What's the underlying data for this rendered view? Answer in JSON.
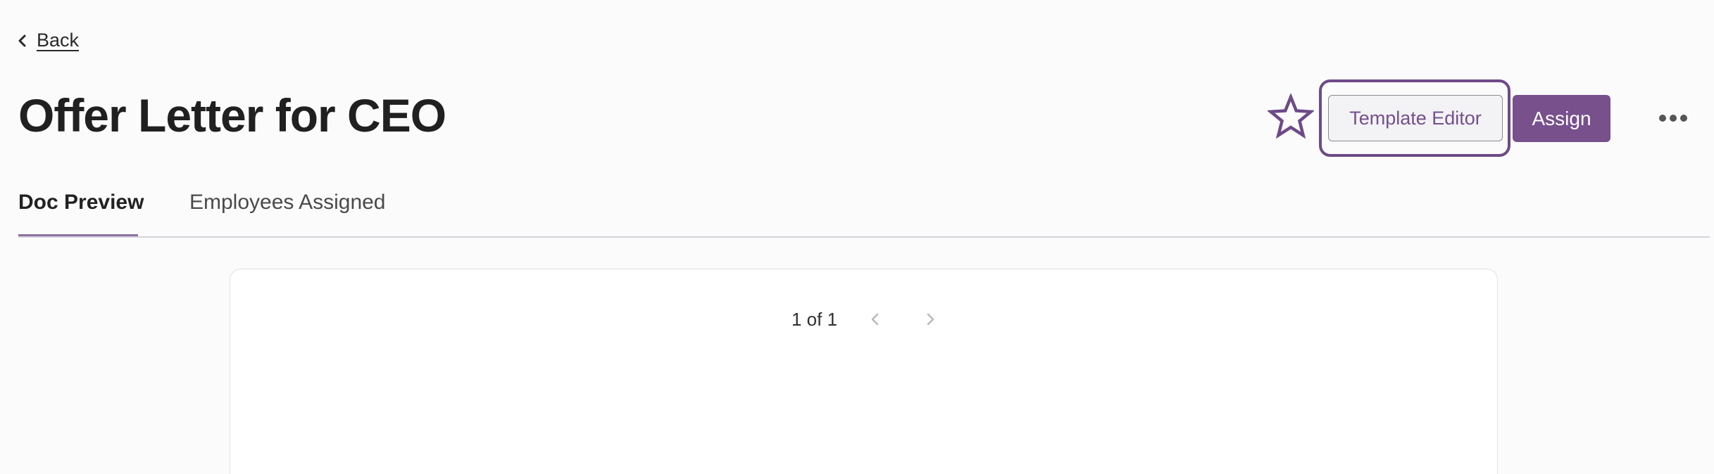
{
  "nav": {
    "back_label": "Back"
  },
  "header": {
    "title": "Offer Letter for CEO",
    "template_editor_label": "Template Editor",
    "assign_label": "Assign"
  },
  "tabs": [
    {
      "label": "Doc Preview",
      "active": true
    },
    {
      "label": "Employees Assigned",
      "active": false
    }
  ],
  "preview": {
    "page_indicator": "1 of 1"
  },
  "colors": {
    "brand": "#77508c",
    "focus": "#6e4a87",
    "background": "#fbfbfb"
  },
  "icons": {
    "back": "chevron-left-icon",
    "favorite": "star-outline-icon",
    "more": "more-horizontal-icon",
    "prev_page": "chevron-left-icon",
    "next_page": "chevron-right-icon"
  }
}
